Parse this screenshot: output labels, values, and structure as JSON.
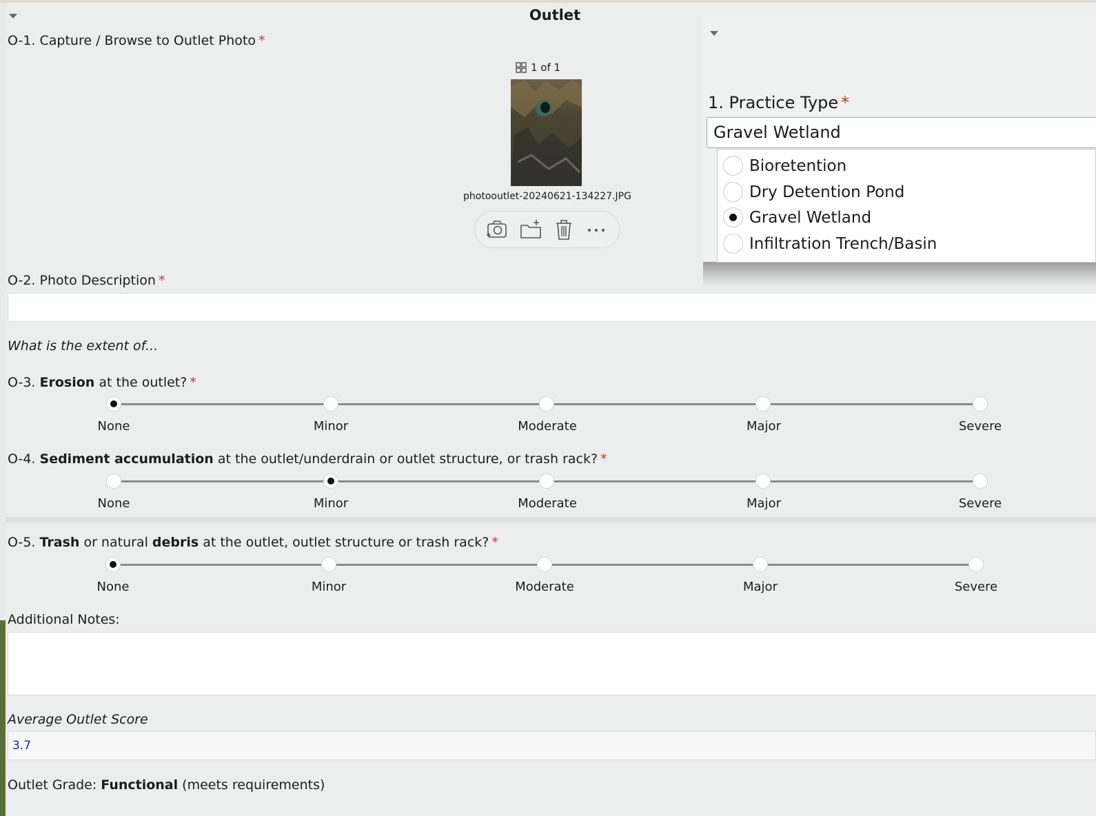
{
  "section": {
    "title": "Outlet"
  },
  "q1": {
    "label": "O-1. Capture / Browse to Outlet Photo",
    "required": "*",
    "counter": "1 of 1",
    "filename": "photooutlet-20240621-134227.JPG"
  },
  "q2": {
    "label": "O-2. Photo Description",
    "required": "*",
    "value": ""
  },
  "prompt": "What is the extent of...",
  "q3": {
    "prefix": "O-3. ",
    "bold": "Erosion",
    "suffix": " at the outlet?",
    "required": "*",
    "selected": "None"
  },
  "q4": {
    "prefix": "O-4. ",
    "bold": "Sediment accumulation",
    "suffix": " at the outlet/underdrain or outlet structure, or trash rack?",
    "required": "*",
    "selected": "Minor"
  },
  "q5": {
    "prefix": "O-5. ",
    "bold1": "Trash",
    "mid": " or natural ",
    "bold2": "debris",
    "suffix": " at the outlet, outlet structure or trash rack?",
    "required": "*",
    "selected": "None"
  },
  "scale": [
    "None",
    "Minor",
    "Moderate",
    "Major",
    "Severe"
  ],
  "notes": {
    "label": "Additional Notes:",
    "value": ""
  },
  "score": {
    "label": "Average Outlet Score",
    "value": "3.7"
  },
  "grade": {
    "prefix": "Outlet Grade: ",
    "bold": "Functional",
    "suffix": " (meets requirements)"
  },
  "practice_type": {
    "label": "1. Practice Type",
    "required": "*",
    "value": "Gravel Wetland",
    "options": [
      "Bioretention",
      "Dry Detention Pond",
      "Gravel Wetland",
      "Infiltration Trench/Basin"
    ],
    "selected": "Gravel Wetland"
  },
  "icons": [
    "caret-down-icon",
    "gallery-grid-icon",
    "camera-icon",
    "add-folder-icon",
    "trash-icon",
    "more-icon"
  ]
}
